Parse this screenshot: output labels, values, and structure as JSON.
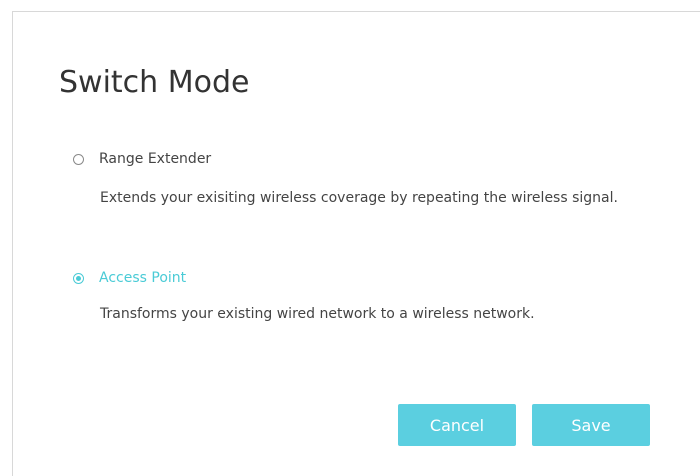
{
  "dialog": {
    "title": "Switch Mode",
    "options": [
      {
        "label": "Range Extender",
        "description": "Extends your exisiting wireless coverage by repeating the wireless signal.",
        "selected": false
      },
      {
        "label": "Access Point",
        "description": "Transforms your existing wired network to a wireless network.",
        "selected": true
      }
    ],
    "buttons": {
      "cancel_label": "Cancel",
      "save_label": "Save"
    }
  },
  "colors": {
    "accent": "#4acbd6",
    "button": "#5bcfe0",
    "text": "#444444",
    "title": "#333333"
  }
}
